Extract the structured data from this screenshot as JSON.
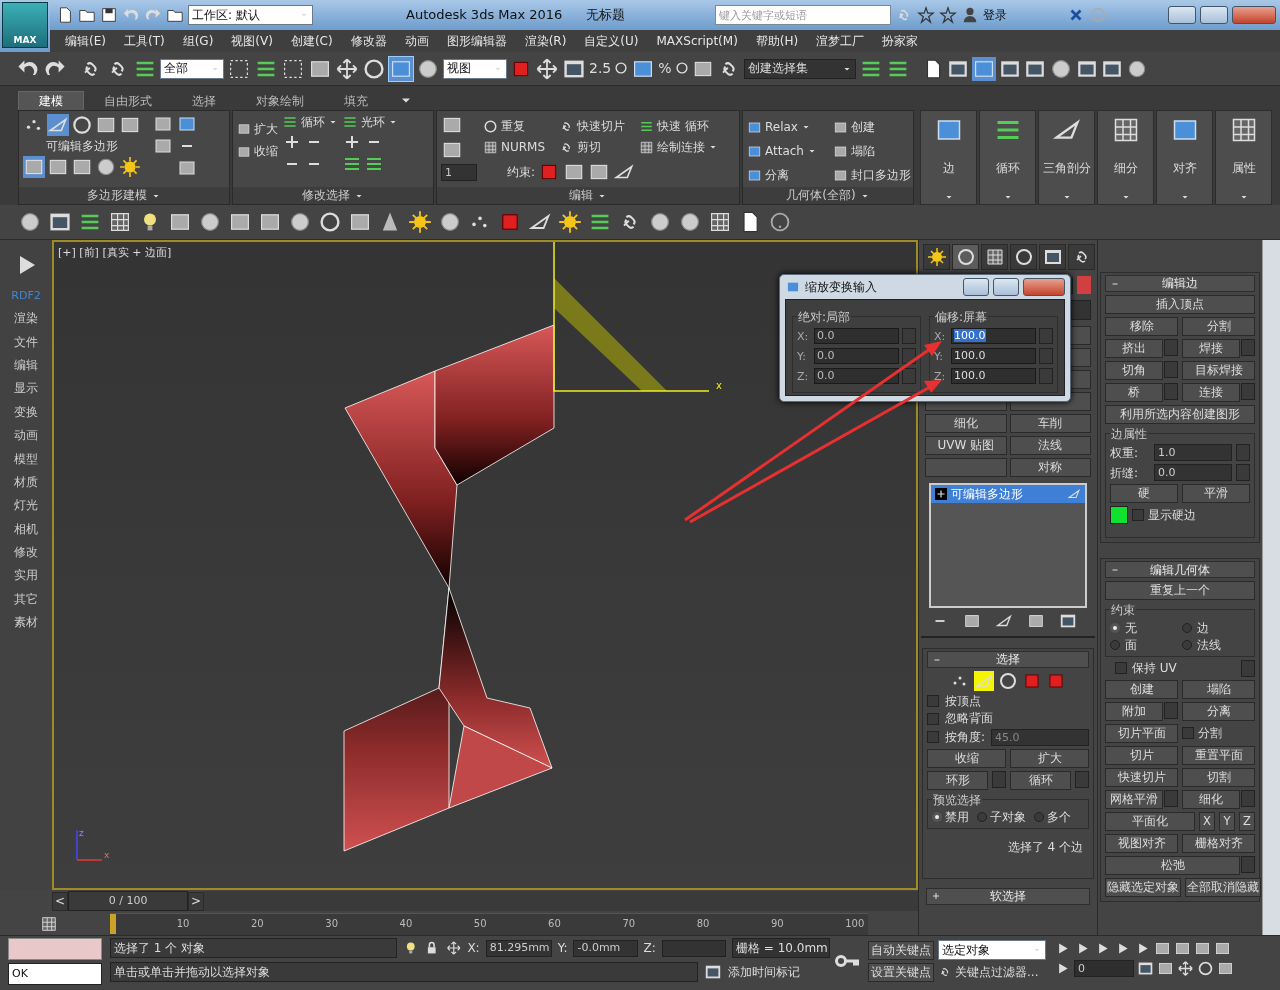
{
  "window": {
    "app_badge": "MAX",
    "title": "Autodesk 3ds Max 2016",
    "document": "无标题"
  },
  "workspace": "工作区: 默认",
  "search": {
    "placeholder": "键入关键字或短语"
  },
  "account": "登录",
  "menu": [
    "编辑(E)",
    "工具(T)",
    "组(G)",
    "视图(V)",
    "创建(C)",
    "修改器",
    "动画",
    "图形编辑器",
    "渲染(R)",
    "自定义(U)",
    "MAXScript(M)",
    "帮助(H)",
    "渲梦工厂",
    "扮家家"
  ],
  "toolbar": {
    "selection_filter": "全部",
    "coordinate_system": "视图",
    "snap_labels": [
      "2.5",
      "%"
    ],
    "named_selection": "创建选择集"
  },
  "ribbon": {
    "tabs": [
      {
        "label": "建模",
        "selected": true
      },
      {
        "label": "自由形式",
        "selected": false
      },
      {
        "label": "选择",
        "selected": false
      },
      {
        "label": "对象绘制",
        "selected": false
      },
      {
        "label": "填充",
        "selected": false
      }
    ],
    "poly_panel": {
      "object": "可编辑多边形",
      "footer": "多边形建模"
    },
    "modify_panel": {
      "grow": "扩大",
      "shrink": "收缩",
      "loop": "循环",
      "ring": "光环",
      "footer": "修改选择"
    },
    "edit_panel": {
      "spinner": "1",
      "items": [
        "重复",
        "快速切片",
        "快速 循环",
        "NURMS",
        "剪切",
        "绘制连接"
      ],
      "constraint": "约束:",
      "footer": "编辑"
    },
    "geometry_panel": {
      "items": [
        "Relax",
        "创建",
        "Attach",
        "塌陷",
        "分离",
        "封口多边形"
      ],
      "footer": "几何体(全部)"
    },
    "big_buttons": [
      "边",
      "循环",
      "三角剖分",
      "细分",
      "对齐",
      "属性"
    ]
  },
  "sidebar": [
    "RDF2",
    "渲染",
    "文件",
    "编辑",
    "显示",
    "变换",
    "动画",
    "模型",
    "材质",
    "灯光",
    "相机",
    "修改",
    "实用",
    "其它",
    "素材"
  ],
  "viewport": {
    "label": "[+] [前] [真实 + 边面]",
    "gizmo_axis": "x",
    "corner_axes": [
      "z",
      "x"
    ]
  },
  "dialog": {
    "title": "缩放变换输入",
    "groups": [
      {
        "title": "绝对:局部",
        "fields": [
          {
            "axis": "X:",
            "value": "0.0",
            "selected": false
          },
          {
            "axis": "Y:",
            "value": "0.0",
            "selected": false
          },
          {
            "axis": "Z:",
            "value": "0.0",
            "selected": false
          }
        ]
      },
      {
        "title": "偏移:屏幕",
        "fields": [
          {
            "axis": "X:",
            "value": "100.0",
            "selected": true
          },
          {
            "axis": "Y:",
            "value": "100.0",
            "selected": false
          },
          {
            "axis": "Z:",
            "value": "100.0",
            "selected": false
          }
        ]
      }
    ]
  },
  "command_panel": {
    "tabs": [
      {
        "selected": false
      },
      {
        "selected": true
      },
      {
        "selected": false
      },
      {
        "selected": false
      },
      {
        "selected": false
      },
      {
        "selected": false
      }
    ],
    "modifier_buttons": [
      "细化",
      "车削",
      "UVW 贴图",
      "法线",
      "对称"
    ],
    "stack": [
      {
        "label": "可编辑多边形",
        "selected": true
      }
    ],
    "selection": {
      "title": "选择",
      "expanded": true,
      "subobjects": [
        {
          "selected": false
        },
        {
          "selected": true
        },
        {
          "selected": false
        },
        {
          "selected": false
        },
        {
          "selected": false
        }
      ],
      "checks": [
        {
          "label": "按顶点",
          "checked": false
        },
        {
          "label": "忽略背面",
          "checked": false
        },
        {
          "label": "按角度:",
          "checked": false
        }
      ],
      "angle": "45.0",
      "buttons": [
        "收缩",
        "扩大",
        "环形",
        "循环"
      ],
      "preview": {
        "title": "预览选择",
        "options": [
          {
            "label": "禁用",
            "selected": true
          },
          {
            "label": "子对象",
            "selected": false
          },
          {
            "label": "多个",
            "selected": false
          }
        ]
      },
      "status": "选择了 4 个边"
    },
    "soft_selection": {
      "title": "软选择",
      "expanded": false
    }
  },
  "edit_edges": {
    "title": "编辑边",
    "expanded": true,
    "rows": [
      [
        {
          "kind": "button",
          "label": "插入顶点",
          "settings": false
        }
      ],
      [
        {
          "kind": "button",
          "label": "移除",
          "settings": false
        },
        {
          "kind": "button",
          "label": "分割",
          "settings": false
        }
      ],
      [
        {
          "kind": "button",
          "label": "挤出",
          "settings": true
        },
        {
          "kind": "button",
          "label": "焊接",
          "settings": true
        }
      ],
      [
        {
          "kind": "button",
          "label": "切角",
          "settings": true
        },
        {
          "kind": "button",
          "label": "目标焊接",
          "settings": false
        }
      ],
      [
        {
          "kind": "button",
          "label": "桥",
          "settings": true
        },
        {
          "kind": "button",
          "label": "连接",
          "settings": true
        }
      ],
      [
        {
          "kind": "button",
          "label": "利用所选内容创建图形",
          "settings": false
        }
      ]
    ],
    "properties": {
      "title": "边属性",
      "weight_label": "权重:",
      "weight": "1.0",
      "crease_label": "折缝:",
      "crease": "0.0",
      "hard": "硬",
      "smooth": "平滑",
      "show_hard": {
        "label": "显示硬边",
        "checked": false
      }
    }
  },
  "edit_geometry": {
    "title": "编辑几何体",
    "expanded": true,
    "repeat": "重复上一个",
    "constraints": {
      "title": "约束",
      "options": [
        {
          "label": "无",
          "selected": true
        },
        {
          "label": "边",
          "selected": false
        },
        {
          "label": "面",
          "selected": false
        },
        {
          "label": "法线",
          "selected": false
        }
      ]
    },
    "preserve_uv": {
      "label": "保持 UV",
      "checked": false
    },
    "rows": [
      [
        {
          "kind": "button",
          "label": "创建",
          "settings": false
        },
        {
          "kind": "button",
          "label": "塌陷",
          "settings": false
        }
      ],
      [
        {
          "kind": "button",
          "label": "附加",
          "settings": true
        },
        {
          "kind": "button",
          "label": "分离",
          "settings": false
        }
      ],
      [
        {
          "kind": "button",
          "label": "切片平面",
          "settings": false
        },
        {
          "kind": "check",
          "label": "分割",
          "checked": false
        }
      ],
      [
        {
          "kind": "button",
          "label": "切片",
          "settings": false
        },
        {
          "kind": "button",
          "label": "重置平面",
          "settings": false
        }
      ],
      [
        {
          "kind": "button",
          "label": "快速切片",
          "settings": false
        },
        {
          "kind": "button",
          "label": "切割",
          "settings": false
        }
      ],
      [
        {
          "kind": "button",
          "label": "网格平滑",
          "settings": true
        },
        {
          "kind": "button",
          "label": "细化",
          "settings": true
        }
      ],
      [
        {
          "kind": "button",
          "label": "平面化",
          "settings": false
        },
        {
          "kind": "axis",
          "label": "X"
        },
        {
          "kind": "axis",
          "label": "Y"
        },
        {
          "kind": "axis",
          "label": "Z"
        }
      ],
      [
        {
          "kind": "button",
          "label": "视图对齐",
          "settings": false
        },
        {
          "kind": "button",
          "label": "栅格对齐",
          "settings": false
        }
      ],
      [
        {
          "kind": "button",
          "label": "松弛",
          "settings": true
        }
      ],
      [
        {
          "kind": "button",
          "label": "隐藏选定对象",
          "settings": false
        },
        {
          "kind": "button",
          "label": "全部取消隐藏",
          "settings": false
        }
      ]
    ]
  },
  "time": {
    "prev": "<",
    "position": "0 / 100",
    "next": ">",
    "ticks": [
      "10",
      "20",
      "30",
      "40",
      "50",
      "60",
      "70",
      "80",
      "90",
      "100"
    ]
  },
  "status": {
    "script_field": "OK",
    "selected": "选择了 1 个 对象",
    "prompt": "单击或单击并拖动以选择对象",
    "x_label": "X:",
    "x": "81.295mm",
    "y_label": "Y:",
    "y": "-0.0mm",
    "z_label": "Z:",
    "grid": "栅格 = 10.0mm",
    "add_time_tag": "添加时间标记",
    "auto_key": "自动关键点",
    "key_mode": "选定对象",
    "set_key": "设置关键点",
    "key_filters": "关键点过滤器...",
    "frame": "0"
  }
}
